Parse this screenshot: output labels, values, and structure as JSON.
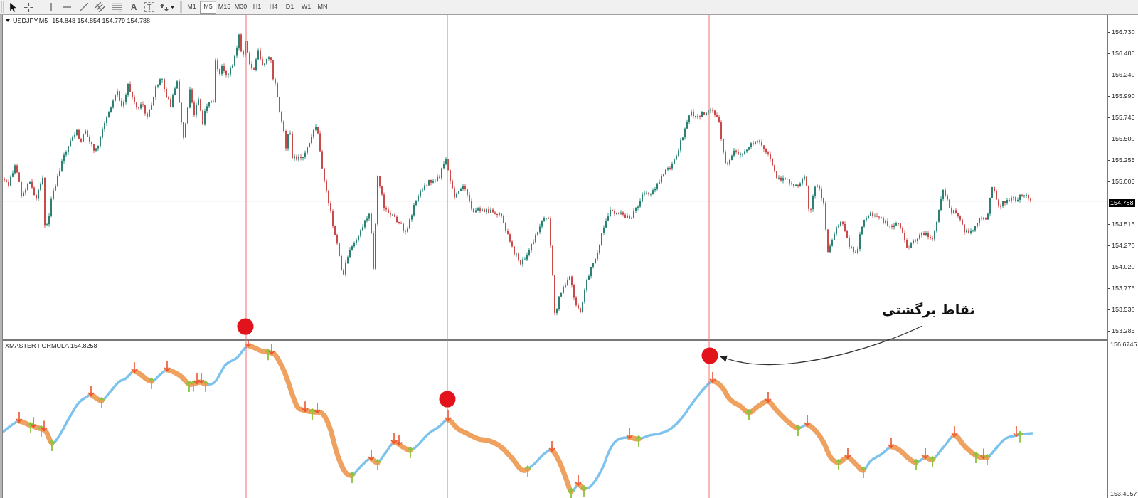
{
  "toolbar": {
    "text_tool": "A",
    "label_tool": "T",
    "timeframes": [
      {
        "label": "M1",
        "selected": false
      },
      {
        "label": "M5",
        "selected": true
      },
      {
        "label": "M15",
        "selected": false
      },
      {
        "label": "M30",
        "selected": false
      },
      {
        "label": "H1",
        "selected": false
      },
      {
        "label": "H4",
        "selected": false
      },
      {
        "label": "D1",
        "selected": false
      },
      {
        "label": "W1",
        "selected": false
      },
      {
        "label": "MN",
        "selected": false
      }
    ]
  },
  "price_chart": {
    "symbol": "USDJPY,M5",
    "ohlc": "154.848 154.854 154.779 154.788",
    "price_scale": [
      {
        "kind": "tick",
        "label": "156.730"
      },
      {
        "kind": "tick",
        "label": "156.485"
      },
      {
        "kind": "tick",
        "label": "156.240"
      },
      {
        "kind": "tick",
        "label": "155.990"
      },
      {
        "kind": "tick",
        "label": "155.745"
      },
      {
        "kind": "tick",
        "label": "155.500"
      },
      {
        "kind": "tick",
        "label": "155.255"
      },
      {
        "kind": "tick",
        "label": "155.005"
      },
      {
        "kind": "current",
        "label": "154.788"
      },
      {
        "kind": "tick",
        "label": "154.515"
      },
      {
        "kind": "tick",
        "label": "154.270"
      },
      {
        "kind": "tick",
        "label": "154.020"
      },
      {
        "kind": "tick",
        "label": "153.775"
      },
      {
        "kind": "tick",
        "label": "153.530"
      },
      {
        "kind": "tick",
        "label": "153.285"
      }
    ]
  },
  "indicator": {
    "title": "XMASTER FORMULA 154.8258",
    "scale": [
      "156.6745",
      "153.4057"
    ]
  },
  "annotation": {
    "text": "نقاط برگشتی"
  }
}
